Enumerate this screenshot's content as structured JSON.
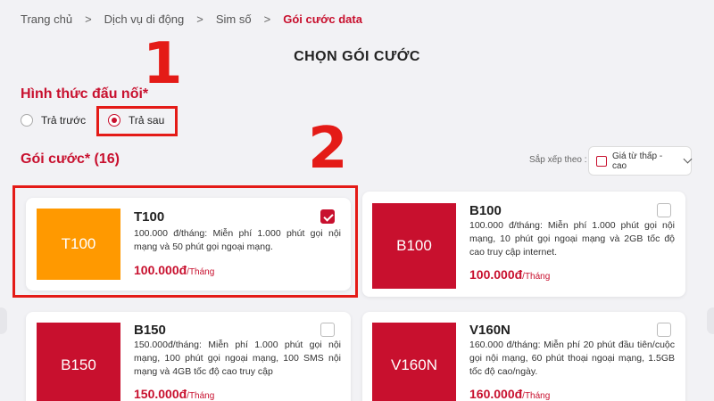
{
  "breadcrumb": {
    "items": [
      "Trang chủ",
      "Dịch vụ di động",
      "Sim số",
      "Gói cước data"
    ],
    "separator": ">"
  },
  "page_title": "CHỌN GÓI CƯỚC",
  "connection": {
    "title": "Hình thức đấu nối*",
    "options": [
      {
        "label": "Trả trước",
        "selected": false
      },
      {
        "label": "Trả sau",
        "selected": true
      }
    ]
  },
  "annotations": {
    "step1": "1",
    "step2": "2"
  },
  "packages": {
    "title": "Gói cước* (16)",
    "sort_label": "Sắp xếp theo :",
    "sort_value": "Giá từ thấp - cao",
    "items": [
      {
        "thumb": "T100",
        "name": "T100",
        "desc": "100.000 đ/tháng: Miễn phí 1.000 phút gọi nội mạng và 50 phút gọi ngoại mạng.",
        "price": "100.000đ",
        "unit": "/Tháng",
        "checked": true,
        "color": "#ff9900"
      },
      {
        "thumb": "B100",
        "name": "B100",
        "desc": "100.000 đ/tháng: Miễn phí 1.000 phút gọi nội mạng, 10 phút gọi ngoại mạng và 2GB tốc độ cao truy cập internet.",
        "price": "100.000đ",
        "unit": "/Tháng",
        "checked": false,
        "color": "#c8102e"
      },
      {
        "thumb": "B150",
        "name": "B150",
        "desc": "150.000đ/tháng: Miễn phí 1.000 phút gọi nội mạng, 100 phút gọi ngoại mạng, 100 SMS nội mạng và 4GB tốc độ cao truy cập",
        "price": "150.000đ",
        "unit": "/Tháng",
        "checked": false,
        "color": "#c8102e"
      },
      {
        "thumb": "V160N",
        "name": "V160N",
        "desc": "160.000 đ/tháng: Miễn phí 20 phút đầu tiên/cuộc gọi nội mạng, 60 phút thoại ngoại mạng, 1.5GB tốc độ cao/ngày.",
        "price": "160.000đ",
        "unit": "/Tháng",
        "checked": false,
        "color": "#c8102e"
      }
    ]
  },
  "colors": {
    "brand": "#c8102e",
    "annotation": "#e41b17",
    "highlight_thumb": "#ff9900"
  }
}
